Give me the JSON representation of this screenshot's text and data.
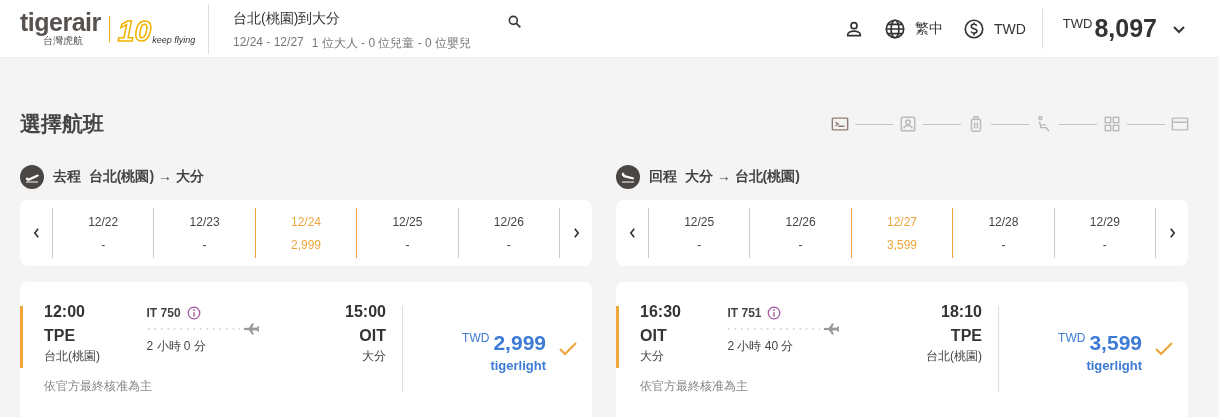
{
  "header": {
    "logo": {
      "brand": "tigerair",
      "subtitle": "台灣虎航",
      "anniversary": "10",
      "slogan": "keep flying"
    },
    "search": {
      "route": "台北(桃園)到大分",
      "dates": "12/24 - 12/27",
      "passengers": "1 位大人 - 0 位兒童 - 0 位嬰兒"
    },
    "language": "繁中",
    "currency": "TWD",
    "total": {
      "currency": "TWD",
      "amount": "8,097"
    }
  },
  "title": "選擇航班",
  "steps": [
    {
      "kind": "flight",
      "active": true
    },
    {
      "kind": "passenger",
      "active": false
    },
    {
      "kind": "baggage",
      "active": false
    },
    {
      "kind": "seat",
      "active": false
    },
    {
      "kind": "services",
      "active": false
    },
    {
      "kind": "payment",
      "active": false
    }
  ],
  "legs": [
    {
      "kind": "depart",
      "label": "去程",
      "origin": "台北(桃園)",
      "arrow": "→",
      "destination": "大分",
      "dates": [
        {
          "date": "12/22",
          "price": "-",
          "selected": false
        },
        {
          "date": "12/23",
          "price": "-",
          "selected": false
        },
        {
          "date": "12/24",
          "price": "2,999",
          "selected": true
        },
        {
          "date": "12/25",
          "price": "-",
          "selected": false
        },
        {
          "date": "12/26",
          "price": "-",
          "selected": false
        }
      ],
      "flight": {
        "selected": true,
        "dep_time": "12:00",
        "dep_code": "TPE",
        "dep_city": "台北(桃園)",
        "number": "IT 750",
        "duration": "2 小時 0 分",
        "arr_time": "15:00",
        "arr_code": "OIT",
        "arr_city": "大分",
        "note": "依官方最終核准為主",
        "currency": "TWD",
        "price": "2,999",
        "fare": "tigerlight"
      }
    },
    {
      "kind": "return",
      "label": "回程",
      "origin": "大分",
      "arrow": "→",
      "destination": "台北(桃園)",
      "dates": [
        {
          "date": "12/25",
          "price": "-",
          "selected": false
        },
        {
          "date": "12/26",
          "price": "-",
          "selected": false
        },
        {
          "date": "12/27",
          "price": "3,599",
          "selected": true
        },
        {
          "date": "12/28",
          "price": "-",
          "selected": false
        },
        {
          "date": "12/29",
          "price": "-",
          "selected": false
        }
      ],
      "flight": {
        "selected": true,
        "dep_time": "16:30",
        "dep_code": "OIT",
        "dep_city": "大分",
        "number": "IT 751",
        "duration": "2 小時 40 分",
        "arr_time": "18:10",
        "arr_code": "TPE",
        "arr_city": "台北(桃園)",
        "note": "依官方最終核准為主",
        "currency": "TWD",
        "price": "3,599",
        "fare": "tigerlight"
      }
    }
  ]
}
